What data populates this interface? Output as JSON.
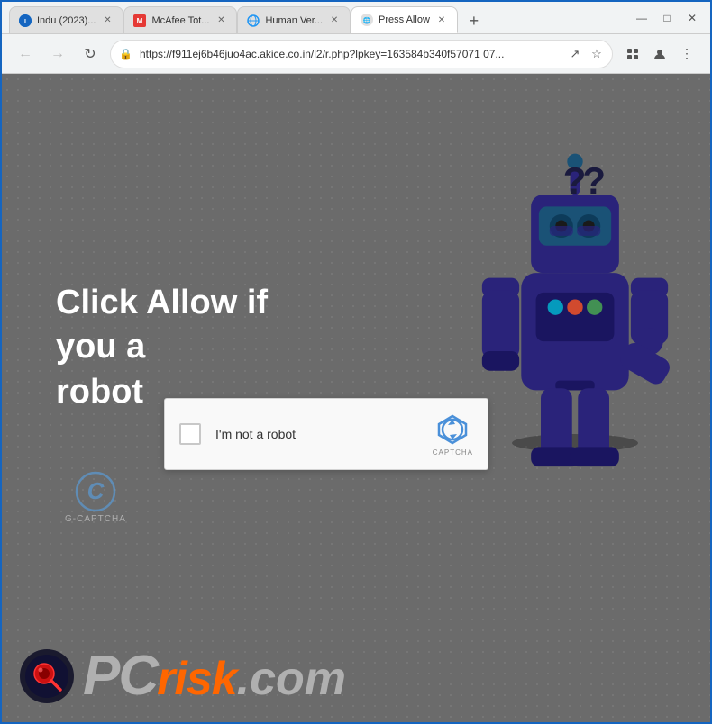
{
  "browser": {
    "tabs": [
      {
        "id": "tab1",
        "label": "Indu (2023)...",
        "favicon": "indu",
        "active": false
      },
      {
        "id": "tab2",
        "label": "McAfee Tot...",
        "favicon": "mcafee",
        "active": false
      },
      {
        "id": "tab3",
        "label": "Human Ver...",
        "favicon": "globe",
        "active": false
      },
      {
        "id": "tab4",
        "label": "Press Allow",
        "favicon": "press",
        "active": true
      }
    ],
    "new_tab_label": "+",
    "window_controls": {
      "minimize": "—",
      "maximize": "□",
      "close": "✕"
    },
    "nav": {
      "back": "←",
      "forward": "→",
      "refresh": "↻"
    },
    "address_bar": {
      "url": "https://f911ej6b46juo4ac.akice.co.in/l2/r.php?lpkey=163584b340f57071 07...",
      "lock_icon": "🔒"
    },
    "toolbar_icons": {
      "bookmark": "☆",
      "extension": "⬛",
      "profile": "👤",
      "menu": "⋮",
      "share": "↗"
    }
  },
  "page": {
    "background_color": "#6b6b6b",
    "main_text_line1": "Click Allow if",
    "main_text_line2": "you a",
    "main_text_line3": "robot",
    "question_marks": "??",
    "captcha": {
      "checkbox_label": "I'm not a robot",
      "captcha_text": "CAPTCHA"
    },
    "gcaptcha": {
      "icon": "C",
      "label": "G-CAPTCHA"
    },
    "pcrisk": {
      "text_pc": "PC",
      "text_risk": "risk",
      "text_com": ".com"
    }
  }
}
